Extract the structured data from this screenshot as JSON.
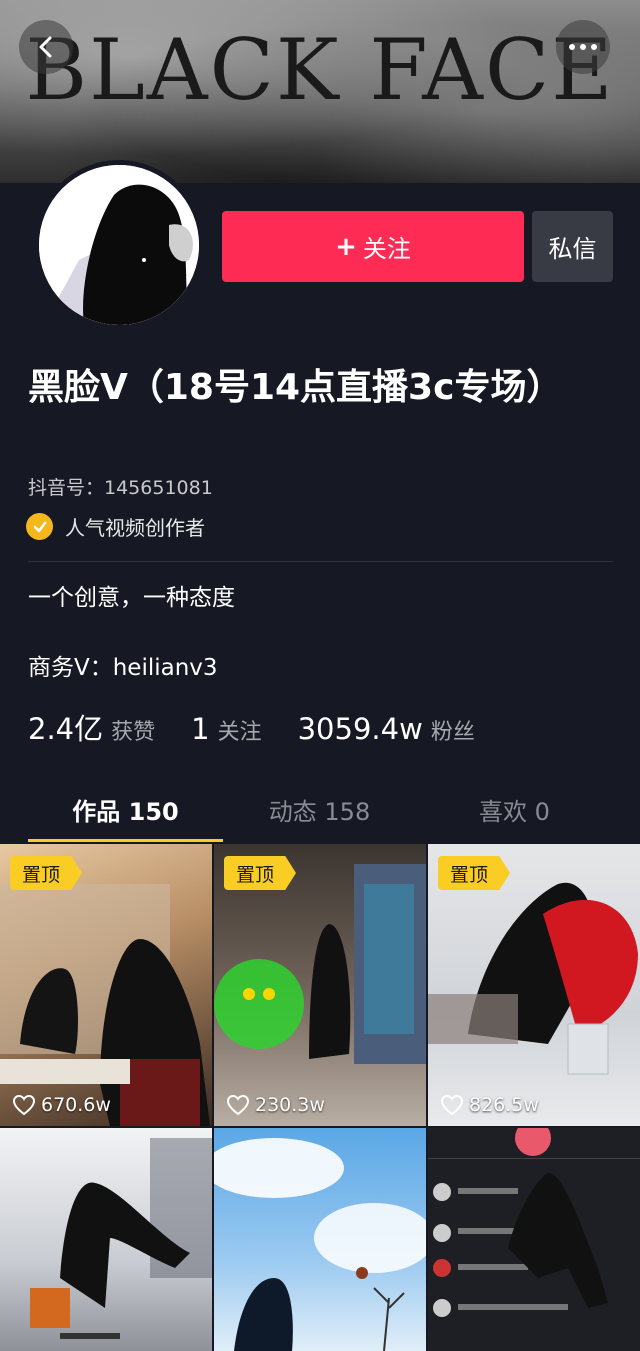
{
  "banner": {
    "title": "BLACK  FACE"
  },
  "profile": {
    "follow_label": "关注",
    "message_label": "私信",
    "nickname": "黑脸V（18号14点直播3c专场）",
    "douyin_id": "抖音号：145651081",
    "creator_badge": "人气视频创作者",
    "bio": "一个创意，一种态度",
    "business": "商务V：heilianv3"
  },
  "stats": [
    {
      "value": "2.4亿",
      "label": "获赞"
    },
    {
      "value": "1",
      "label": "关注"
    },
    {
      "value": "3059.4w",
      "label": "粉丝"
    }
  ],
  "tabs": [
    {
      "label": "作品 150",
      "active": true
    },
    {
      "label": "动态 158",
      "active": false
    },
    {
      "label": "喜欢 0",
      "active": false
    }
  ],
  "videos": [
    {
      "pinned": true,
      "pin_label": "置顶",
      "likes": "670.6w"
    },
    {
      "pinned": true,
      "pin_label": "置顶",
      "likes": "230.3w"
    },
    {
      "pinned": true,
      "pin_label": "置顶",
      "likes": "826.5w"
    },
    {
      "pinned": false,
      "likes": ""
    },
    {
      "pinned": false,
      "likes": ""
    },
    {
      "pinned": false,
      "likes": ""
    }
  ],
  "colors": {
    "background": "#161823",
    "follow": "#fe2c55",
    "accent": "#facd24",
    "badge": "#f5b81c"
  }
}
